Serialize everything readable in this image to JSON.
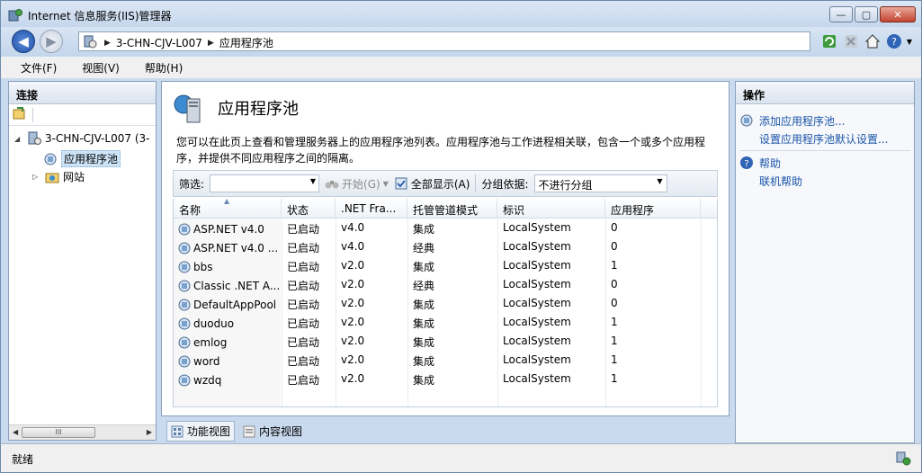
{
  "window": {
    "title": "Internet 信息服务(IIS)管理器"
  },
  "address": {
    "crumbs": [
      "3-CHN-CJV-L007",
      "应用程序池"
    ]
  },
  "menu": {
    "items": [
      "文件(F)",
      "视图(V)",
      "帮助(H)"
    ]
  },
  "connections": {
    "header": "连接",
    "tree": {
      "server": "3-CHN-CJV-L007 (3-",
      "app_pools": "应用程序池",
      "sites": "网站"
    }
  },
  "center": {
    "title": "应用程序池",
    "description": "您可以在此页上查看和管理服务器上的应用程序池列表。应用程序池与工作进程相关联，包含一个或多个应用程序，并提供不同应用程序之间的隔离。",
    "filter": {
      "label": "筛选:",
      "start": "开始(G)",
      "show_all": "全部显示(A)",
      "group_label": "分组依据:",
      "group_value": "不进行分组"
    },
    "table": {
      "columns": [
        "名称",
        "状态",
        ".NET Fra...",
        "托管管道模式",
        "标识",
        "应用程序"
      ],
      "rows": [
        [
          "ASP.NET v4.0",
          "已启动",
          "v4.0",
          "集成",
          "LocalSystem",
          "0"
        ],
        [
          "ASP.NET v4.0 ...",
          "已启动",
          "v4.0",
          "经典",
          "LocalSystem",
          "0"
        ],
        [
          "bbs",
          "已启动",
          "v2.0",
          "集成",
          "LocalSystem",
          "1"
        ],
        [
          "Classic .NET A...",
          "已启动",
          "v2.0",
          "经典",
          "LocalSystem",
          "0"
        ],
        [
          "DefaultAppPool",
          "已启动",
          "v2.0",
          "集成",
          "LocalSystem",
          "0"
        ],
        [
          "duoduo",
          "已启动",
          "v2.0",
          "集成",
          "LocalSystem",
          "1"
        ],
        [
          "emlog",
          "已启动",
          "v2.0",
          "集成",
          "LocalSystem",
          "1"
        ],
        [
          "word",
          "已启动",
          "v2.0",
          "集成",
          "LocalSystem",
          "1"
        ],
        [
          "wzdq",
          "已启动",
          "v2.0",
          "集成",
          "LocalSystem",
          "1"
        ]
      ]
    },
    "view_tabs": {
      "features": "功能视图",
      "content": "内容视图"
    }
  },
  "actions": {
    "header": "操作",
    "add_pool": "添加应用程序池...",
    "set_defaults": "设置应用程序池默认设置...",
    "help": "帮助",
    "online_help": "联机帮助"
  },
  "status": {
    "text": "就绪"
  },
  "colors": {
    "accent": "#1a55a8",
    "selection": "#cde4f7"
  }
}
